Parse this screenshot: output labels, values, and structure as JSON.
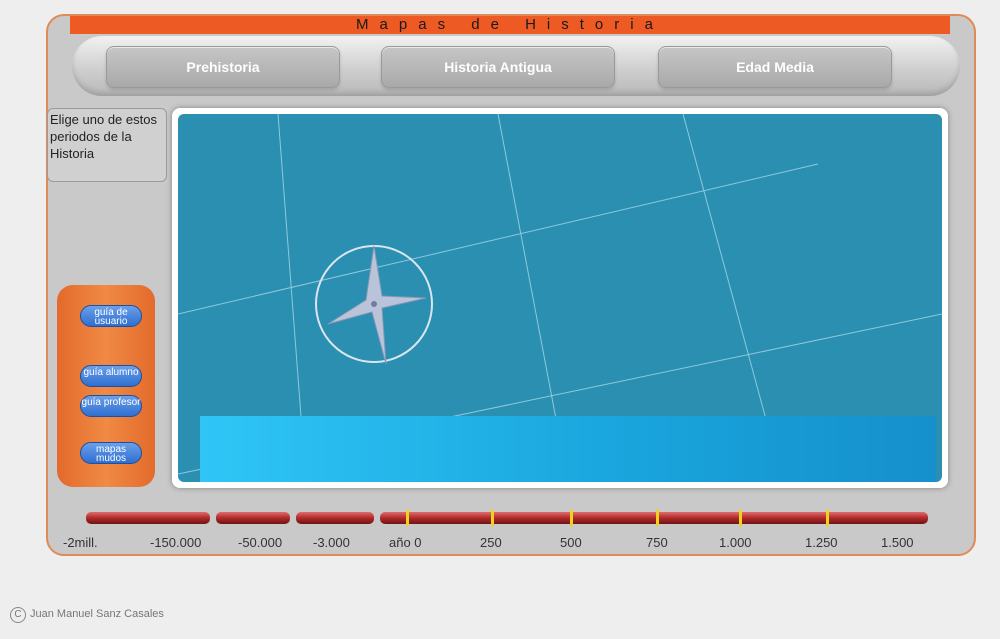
{
  "title": "Mapas de Historia",
  "nav": {
    "items": [
      {
        "label": "Prehistoria"
      },
      {
        "label": "Historia Antigua"
      },
      {
        "label": "Edad Media"
      }
    ]
  },
  "hint": "Elige uno de estos periodos de la Historia",
  "side_buttons": [
    {
      "label": "guía de usuario"
    },
    {
      "label": "guía alumno"
    },
    {
      "label": "guía profesor"
    },
    {
      "label": "mapas mudos"
    }
  ],
  "timeline": {
    "labels": [
      "-2mill.",
      "-150.000",
      "-50.000",
      "-3.000",
      "año 0",
      "250",
      "500",
      "750",
      "1.000",
      "1.250",
      "1.500"
    ]
  },
  "footer": {
    "copyright_symbol": "C",
    "author": "Juan Manuel Sanz Casales"
  },
  "colors": {
    "accent": "#ee5a24",
    "map_sea": "#2a8fb1",
    "caption_bar": "#1aa6de",
    "button_blue": "#2f6fd0"
  },
  "icons": [
    "compass-rose-icon",
    "copyright-icon"
  ]
}
